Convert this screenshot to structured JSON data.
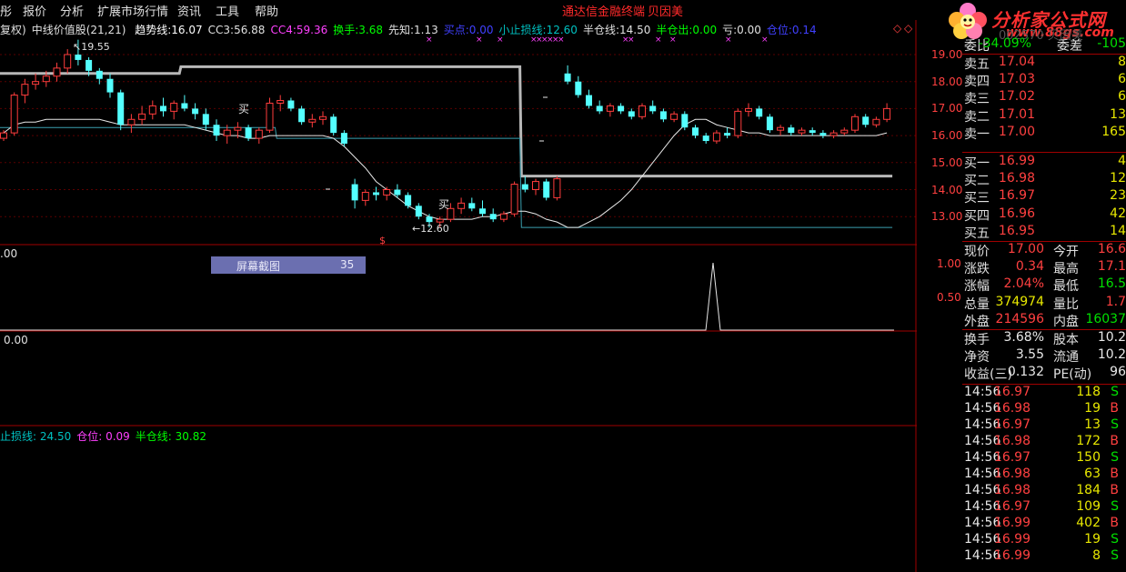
{
  "menu": {
    "items": [
      "彤",
      "报价",
      "分析",
      "扩展市场行情",
      "资讯",
      "工具",
      "帮助"
    ],
    "title": "通达信金融终端",
    "subtitle": "贝因美"
  },
  "logo": {
    "text": "分析家公式网",
    "sub": "www.88gs.com",
    "watermark": "002570 贝因美"
  },
  "indicator_bar": {
    "prefix": "复权)",
    "name": "中线价值股(21,21)",
    "items": [
      {
        "label": "趋势线:",
        "value": "16.07",
        "color": "#ffffff"
      },
      {
        "label": "CC3:",
        "value": "56.88",
        "color": "#e0e0e0"
      },
      {
        "label": "CC4:",
        "value": "59.36",
        "color": "#ff40ff"
      },
      {
        "label": "换手:",
        "value": "3.68",
        "color": "#00ff00"
      },
      {
        "label": "先知:",
        "value": "1.13",
        "color": "#e0e0e0"
      },
      {
        "label": "买点:",
        "value": "0.00",
        "color": "#4040ff"
      },
      {
        "label": "小止损线:",
        "value": "12.60",
        "color": "#00c0c0"
      },
      {
        "label": "半仓线:",
        "value": "14.50",
        "color": "#e0e0e0"
      },
      {
        "label": "半仓出:",
        "value": "0.00",
        "color": "#00ff00"
      },
      {
        "label": "亏:",
        "value": "0.00",
        "color": "#e0e0e0"
      },
      {
        "label": "仓位:",
        "value": "0.14",
        "color": "#4040ff"
      }
    ]
  },
  "price_axis": [
    "19.00",
    "18.00",
    "17.00",
    "16.00",
    "15.00",
    "14.00",
    "13.00"
  ],
  "annotations": {
    "high": "19.55",
    "low": "12.60",
    "buy1": "买",
    "buy2": "买",
    "marker": "$"
  },
  "sub_panel1": {
    "left_value": ".00",
    "axis": [
      "1.00",
      "0.50"
    ]
  },
  "sub_panel2": {
    "left_value": "0.00"
  },
  "sub_panel3": {
    "items": [
      {
        "label": "止损线:",
        "value": "24.50",
        "color": "#00c0c0"
      },
      {
        "label": "仓位:",
        "value": "0.09",
        "color": "#ff40ff"
      },
      {
        "label": "半仓线:",
        "value": "30.82",
        "color": "#00ff00"
      }
    ]
  },
  "popup": {
    "label": "屏幕截图",
    "value": "35"
  },
  "quote": {
    "weibi": {
      "label": "委比",
      "value": "-34.09%",
      "label2": "委差",
      "value2": "-105"
    },
    "asks": [
      {
        "label": "卖五",
        "price": "17.04",
        "vol": "8"
      },
      {
        "label": "卖四",
        "price": "17.03",
        "vol": "6"
      },
      {
        "label": "卖三",
        "price": "17.02",
        "vol": "6"
      },
      {
        "label": "卖二",
        "price": "17.01",
        "vol": "13"
      },
      {
        "label": "卖一",
        "price": "17.00",
        "vol": "165"
      }
    ],
    "bids": [
      {
        "label": "买一",
        "price": "16.99",
        "vol": "4"
      },
      {
        "label": "买二",
        "price": "16.98",
        "vol": "12"
      },
      {
        "label": "买三",
        "price": "16.97",
        "vol": "23"
      },
      {
        "label": "买四",
        "price": "16.96",
        "vol": "42"
      },
      {
        "label": "买五",
        "price": "16.95",
        "vol": "14"
      }
    ],
    "stats": [
      {
        "l1": "现价",
        "v1": "17.00",
        "c1": "red",
        "l2": "今开",
        "v2": "16.6",
        "c2": "red"
      },
      {
        "l1": "涨跌",
        "v1": "0.34",
        "c1": "red",
        "l2": "最高",
        "v2": "17.1",
        "c2": "red"
      },
      {
        "l1": "涨幅",
        "v1": "2.04%",
        "c1": "red",
        "l2": "最低",
        "v2": "16.5",
        "c2": "green"
      },
      {
        "l1": "总量",
        "v1": "374974",
        "c1": "yellow",
        "l2": "量比",
        "v2": "1.7",
        "c2": "red"
      },
      {
        "l1": "外盘",
        "v1": "214596",
        "c1": "red",
        "l2": "内盘",
        "v2": "16037",
        "c2": "green"
      }
    ],
    "fundamentals": [
      {
        "l1": "换手",
        "v1": "3.68%",
        "l2": "股本",
        "v2": "10.2"
      },
      {
        "l1": "净资",
        "v1": "3.55",
        "l2": "流通",
        "v2": "10.2"
      },
      {
        "l1": "收益(三)",
        "v1": "0.132",
        "l2": "PE(动)",
        "v2": "96"
      }
    ],
    "ticks": [
      {
        "time": "14:56",
        "price": "16.97",
        "vol": "118",
        "side": "S"
      },
      {
        "time": "14:56",
        "price": "16.98",
        "vol": "19",
        "side": "B"
      },
      {
        "time": "14:56",
        "price": "16.97",
        "vol": "13",
        "side": "S"
      },
      {
        "time": "14:56",
        "price": "16.98",
        "vol": "172",
        "side": "B"
      },
      {
        "time": "14:56",
        "price": "16.97",
        "vol": "150",
        "side": "S"
      },
      {
        "time": "14:56",
        "price": "16.98",
        "vol": "63",
        "side": "B"
      },
      {
        "time": "14:56",
        "price": "16.98",
        "vol": "184",
        "side": "B"
      },
      {
        "time": "14:56",
        "price": "16.97",
        "vol": "109",
        "side": "S"
      },
      {
        "time": "14:56",
        "price": "16.99",
        "vol": "402",
        "side": "B"
      },
      {
        "time": "14:56",
        "price": "16.99",
        "vol": "19",
        "side": "S"
      },
      {
        "time": "14:56",
        "price": "16.99",
        "vol": "8",
        "side": "S"
      }
    ]
  },
  "candles": [
    [
      15.9,
      16.2,
      15.8,
      16.1
    ],
    [
      16.1,
      17.6,
      16.0,
      17.5
    ],
    [
      17.5,
      18.1,
      17.2,
      17.9
    ],
    [
      17.9,
      18.3,
      17.7,
      18.0
    ],
    [
      18.0,
      18.4,
      17.8,
      18.2
    ],
    [
      18.2,
      18.7,
      18.0,
      18.5
    ],
    [
      18.5,
      19.2,
      18.3,
      19.0
    ],
    [
      19.0,
      19.55,
      18.6,
      18.8
    ],
    [
      18.8,
      18.9,
      18.2,
      18.4
    ],
    [
      18.4,
      18.5,
      17.9,
      18.1
    ],
    [
      18.1,
      18.3,
      17.4,
      17.6
    ],
    [
      17.6,
      17.7,
      16.2,
      16.4
    ],
    [
      16.4,
      16.8,
      16.1,
      16.6
    ],
    [
      16.6,
      17.1,
      16.4,
      16.8
    ],
    [
      16.8,
      17.3,
      16.6,
      17.1
    ],
    [
      17.1,
      17.4,
      16.7,
      16.9
    ],
    [
      16.9,
      17.3,
      16.6,
      17.2
    ],
    [
      17.2,
      17.5,
      16.9,
      17.0
    ],
    [
      17.0,
      17.2,
      16.6,
      16.8
    ],
    [
      16.8,
      17.0,
      16.2,
      16.4
    ],
    [
      16.4,
      16.6,
      15.8,
      16.0
    ],
    [
      16.0,
      16.4,
      15.7,
      16.2
    ],
    [
      16.2,
      16.5,
      15.9,
      16.3
    ],
    [
      16.3,
      16.4,
      15.8,
      15.9
    ],
    [
      15.9,
      16.3,
      15.7,
      16.2
    ],
    [
      16.2,
      17.4,
      16.1,
      17.2
    ],
    [
      17.2,
      17.5,
      16.9,
      17.3
    ],
    [
      17.3,
      17.4,
      16.9,
      17.0
    ],
    [
      17.0,
      17.1,
      16.4,
      16.5
    ],
    [
      16.5,
      16.8,
      16.3,
      16.6
    ],
    [
      16.6,
      16.9,
      16.4,
      16.7
    ],
    [
      16.7,
      16.8,
      16.0,
      16.1
    ],
    [
      16.1,
      16.2,
      15.6,
      15.7
    ],
    [
      14.2,
      14.4,
      13.3,
      13.6
    ],
    [
      13.6,
      14.0,
      13.4,
      13.9
    ],
    [
      13.9,
      14.1,
      13.6,
      13.8
    ],
    [
      13.8,
      14.1,
      13.6,
      14.0
    ],
    [
      14.0,
      14.2,
      13.7,
      13.8
    ],
    [
      13.8,
      13.9,
      13.3,
      13.4
    ],
    [
      13.4,
      13.5,
      12.9,
      13.0
    ],
    [
      13.0,
      13.1,
      12.6,
      12.8
    ],
    [
      12.8,
      13.0,
      12.6,
      12.9
    ],
    [
      12.9,
      13.5,
      12.8,
      13.3
    ],
    [
      13.3,
      13.7,
      13.1,
      13.5
    ],
    [
      13.5,
      13.7,
      13.2,
      13.3
    ],
    [
      13.3,
      13.6,
      13.0,
      13.1
    ],
    [
      13.1,
      13.3,
      12.8,
      12.9
    ],
    [
      12.9,
      13.2,
      12.8,
      13.1
    ],
    [
      13.1,
      14.3,
      13.0,
      14.2
    ],
    [
      14.2,
      14.5,
      13.9,
      14.0
    ],
    [
      14.0,
      14.4,
      13.8,
      14.3
    ],
    [
      14.3,
      14.4,
      13.6,
      13.7
    ],
    [
      13.7,
      14.5,
      13.6,
      14.4
    ],
    [
      18.3,
      18.6,
      17.9,
      18.0
    ],
    [
      18.0,
      18.2,
      17.4,
      17.5
    ],
    [
      17.5,
      17.7,
      17.0,
      17.1
    ],
    [
      17.1,
      17.3,
      16.8,
      16.9
    ],
    [
      16.9,
      17.2,
      16.7,
      17.1
    ],
    [
      17.1,
      17.2,
      16.8,
      16.9
    ],
    [
      16.9,
      17.0,
      16.6,
      16.7
    ],
    [
      16.7,
      17.2,
      16.6,
      17.1
    ],
    [
      17.1,
      17.3,
      16.8,
      16.9
    ],
    [
      16.9,
      17.0,
      16.5,
      16.6
    ],
    [
      16.6,
      16.9,
      16.5,
      16.8
    ],
    [
      16.8,
      16.9,
      16.2,
      16.3
    ],
    [
      16.3,
      16.4,
      15.9,
      16.0
    ],
    [
      16.0,
      16.1,
      15.7,
      15.8
    ],
    [
      15.8,
      16.2,
      15.7,
      16.1
    ],
    [
      16.1,
      16.3,
      15.9,
      16.0
    ],
    [
      16.0,
      17.0,
      15.9,
      16.9
    ],
    [
      16.9,
      17.2,
      16.7,
      17.0
    ],
    [
      17.0,
      17.1,
      16.6,
      16.7
    ],
    [
      16.7,
      16.8,
      16.1,
      16.2
    ],
    [
      16.2,
      16.4,
      16.0,
      16.3
    ],
    [
      16.3,
      16.4,
      16.0,
      16.1
    ],
    [
      16.1,
      16.3,
      16.0,
      16.2
    ],
    [
      16.2,
      16.3,
      16.0,
      16.1
    ],
    [
      16.1,
      16.2,
      15.9,
      16.0
    ],
    [
      16.0,
      16.2,
      15.9,
      16.1
    ],
    [
      16.1,
      16.3,
      16.0,
      16.2
    ],
    [
      16.2,
      16.8,
      16.1,
      16.7
    ],
    [
      16.7,
      16.8,
      16.3,
      16.4
    ],
    [
      16.4,
      16.7,
      16.3,
      16.6
    ],
    [
      16.6,
      17.2,
      16.5,
      17.0
    ]
  ],
  "trend_line": [
    16.1,
    16.4,
    16.5,
    16.5,
    16.6,
    16.6,
    16.6,
    16.6,
    16.6,
    16.6,
    16.5,
    16.4,
    16.4,
    16.4,
    16.4,
    16.4,
    16.4,
    16.4,
    16.3,
    16.2,
    16.1,
    16.0,
    16.0,
    15.9,
    15.9,
    16.0,
    16.0,
    16.0,
    16.0,
    16.0,
    16.0,
    15.9,
    15.6,
    15.2,
    14.8,
    14.3,
    14.0,
    13.7,
    13.4,
    13.2,
    13.0,
    12.9,
    12.9,
    12.9,
    12.9,
    13.0,
    13.0,
    13.1,
    13.2,
    13.2,
    13.1,
    12.9,
    12.8,
    12.6,
    12.6,
    12.8,
    13.0,
    13.3,
    13.6,
    14.0,
    14.5,
    15.0,
    15.5,
    16.0,
    16.4,
    16.6,
    16.6,
    16.4,
    16.3,
    16.2,
    16.1,
    16.1,
    16.0,
    16.0,
    16.0,
    16.0,
    16.0,
    16.0,
    16.0,
    16.0,
    16.0,
    16.0,
    16.0,
    16.1
  ],
  "half_line": [
    {
      "from": 0,
      "to": 16,
      "v": 18.3
    },
    {
      "from": 17,
      "to": 48,
      "v": 18.55
    },
    {
      "from": 49,
      "to": 83,
      "v": 14.5
    }
  ],
  "stop_line": [
    {
      "from": 0,
      "to": 25,
      "v": 16.3
    },
    {
      "from": 26,
      "to": 48,
      "v": 15.9
    },
    {
      "from": 49,
      "to": 83,
      "v": 12.6
    }
  ]
}
